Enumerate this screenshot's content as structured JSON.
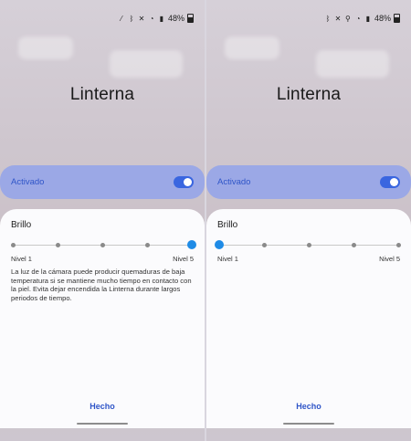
{
  "screens": [
    {
      "status": {
        "battery": "48%",
        "icons": [
          "mute-icon",
          "bluetooth-icon",
          "vibrate-icon",
          "wifi-icon",
          "signal-icon",
          "battery-icon"
        ]
      },
      "title": "Linterna",
      "toggle": {
        "label": "Activado",
        "on": true
      },
      "sheet": {
        "title": "Brillo",
        "slider": {
          "levels": 5,
          "value": 5
        },
        "min_label": "Nivel 1",
        "max_label": "Nivel 5",
        "warning": "La luz de la cámara puede producir quemaduras de baja temperatura si se mantiene mucho tiempo en contacto con la piel. Evita dejar encendida la Linterna durante largos periodos de tiempo.",
        "done_label": "Hecho"
      }
    },
    {
      "status": {
        "battery": "48%",
        "icons": [
          "bluetooth-icon",
          "vibrate-icon",
          "location-icon",
          "wifi-icon",
          "signal-icon",
          "battery-icon"
        ]
      },
      "title": "Linterna",
      "toggle": {
        "label": "Activado",
        "on": true
      },
      "sheet": {
        "title": "Brillo",
        "slider": {
          "levels": 5,
          "value": 1
        },
        "min_label": "Nivel 1",
        "max_label": "Nivel 5",
        "done_label": "Hecho"
      }
    }
  ],
  "colors": {
    "accent": "#1f8be6",
    "active_bar": "#9ba8e6",
    "link": "#2f55c8"
  }
}
